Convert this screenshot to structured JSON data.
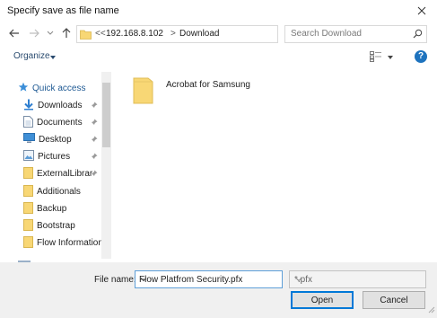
{
  "window": {
    "title": "Specify save as file name"
  },
  "address": {
    "overflow": "<<",
    "crumbs": [
      "192.168.8.102",
      "Download"
    ],
    "separator": ">"
  },
  "search": {
    "placeholder": "Search Download"
  },
  "toolbar": {
    "organize_label": "Organize",
    "help_label": "?"
  },
  "sidebar": {
    "items": [
      {
        "label": "Quick access",
        "icon": "star-icon",
        "pinned": false
      },
      {
        "label": "Downloads",
        "icon": "download-arrow-icon",
        "pinned": true
      },
      {
        "label": "Documents",
        "icon": "documents-icon",
        "pinned": true
      },
      {
        "label": "Desktop",
        "icon": "desktop-icon",
        "pinned": true
      },
      {
        "label": "Pictures",
        "icon": "pictures-icon",
        "pinned": true
      },
      {
        "label": "ExternalLibrar",
        "icon": "folder-icon",
        "pinned": true
      },
      {
        "label": "Additionals",
        "icon": "folder-icon",
        "pinned": false
      },
      {
        "label": "Backup",
        "icon": "folder-icon",
        "pinned": false
      },
      {
        "label": "Bootstrap",
        "icon": "folder-icon",
        "pinned": false
      },
      {
        "label": "Flow Information",
        "icon": "folder-icon",
        "pinned": false
      }
    ]
  },
  "content": {
    "items": [
      {
        "name": "Acrobat for Samsung",
        "icon": "folder-icon"
      }
    ]
  },
  "footer": {
    "filename_label": "File name:",
    "filename_value": "Flow Platfrom Security.pfx",
    "filetype_value": "*.pfx",
    "open_label": "Open",
    "cancel_label": "Cancel"
  },
  "colors": {
    "accent": "#0078d7",
    "folder": "#f8d775",
    "link": "#1f5a94"
  }
}
